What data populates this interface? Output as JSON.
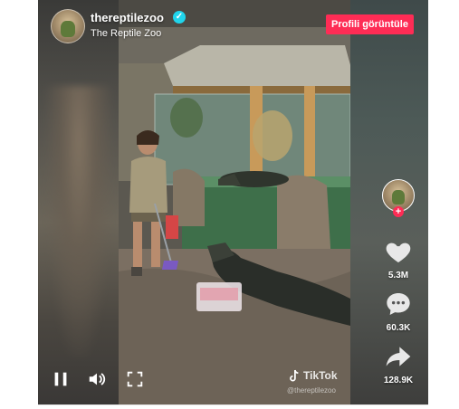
{
  "header": {
    "username": "thereptilezoo",
    "display_name": "The Reptile Zoo",
    "profile_button": "Profili görüntüle"
  },
  "rail": {
    "likes": "5.3M",
    "comments": "60.3K",
    "shares": "128.9K"
  },
  "watermark": {
    "brand": "TikTok",
    "user": "@thereptilezoo"
  },
  "icons": {
    "verified": "verified-badge-icon",
    "like": "heart-icon",
    "comment": "comment-icon",
    "share": "share-icon",
    "play_pause": "pause-icon",
    "volume": "volume-icon",
    "fullscreen": "fullscreen-icon"
  },
  "colors": {
    "accent": "#fe2c55",
    "verified": "#20d5ec"
  }
}
